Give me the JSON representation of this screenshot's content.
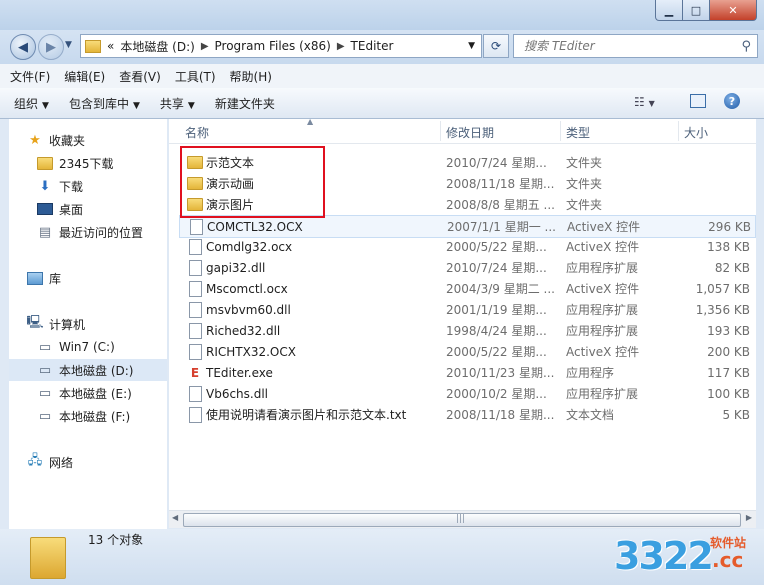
{
  "address": {
    "back_symbol": "«",
    "segments": [
      "本地磁盘 (D:)",
      "Program Files (x86)",
      "TEditer"
    ]
  },
  "search": {
    "placeholder": "搜索 TEditer"
  },
  "menu": [
    "文件(F)",
    "编辑(E)",
    "查看(V)",
    "工具(T)",
    "帮助(H)"
  ],
  "commands": [
    "组织",
    "包含到库中",
    "共享",
    "新建文件夹"
  ],
  "nav": {
    "favorites": "收藏夹",
    "fav_items": [
      "2345下载",
      "下载",
      "桌面",
      "最近访问的位置"
    ],
    "library": "库",
    "computer": "计算机",
    "drives": [
      "Win7 (C:)",
      "本地磁盘 (D:)",
      "本地磁盘 (E:)",
      "本地磁盘 (F:)"
    ],
    "network": "网络"
  },
  "columns": {
    "name": "名称",
    "date": "修改日期",
    "type": "类型",
    "size": "大小"
  },
  "files": [
    {
      "name": "示范文本",
      "date": "2010/7/24 星期...",
      "type": "文件夹",
      "size": "",
      "kind": "folder"
    },
    {
      "name": "演示动画",
      "date": "2008/11/18 星期...",
      "type": "文件夹",
      "size": "",
      "kind": "folder"
    },
    {
      "name": "演示图片",
      "date": "2008/8/8 星期五 ...",
      "type": "文件夹",
      "size": "",
      "kind": "folder"
    },
    {
      "name": "COMCTL32.OCX",
      "date": "2007/1/1 星期一 ...",
      "type": "ActiveX 控件",
      "size": "296 KB",
      "kind": "file"
    },
    {
      "name": "Comdlg32.ocx",
      "date": "2000/5/22 星期...",
      "type": "ActiveX 控件",
      "size": "138 KB",
      "kind": "file"
    },
    {
      "name": "gapi32.dll",
      "date": "2010/7/24 星期...",
      "type": "应用程序扩展",
      "size": "82 KB",
      "kind": "file"
    },
    {
      "name": "Mscomctl.ocx",
      "date": "2004/3/9 星期二 ...",
      "type": "ActiveX 控件",
      "size": "1,057 KB",
      "kind": "file"
    },
    {
      "name": "msvbvm60.dll",
      "date": "2001/1/19 星期...",
      "type": "应用程序扩展",
      "size": "1,356 KB",
      "kind": "file"
    },
    {
      "name": "Riched32.dll",
      "date": "1998/4/24 星期...",
      "type": "应用程序扩展",
      "size": "193 KB",
      "kind": "file"
    },
    {
      "name": "RICHTX32.OCX",
      "date": "2000/5/22 星期...",
      "type": "ActiveX 控件",
      "size": "200 KB",
      "kind": "file"
    },
    {
      "name": "TEditer.exe",
      "date": "2010/11/23 星期...",
      "type": "应用程序",
      "size": "117 KB",
      "kind": "exe"
    },
    {
      "name": "Vb6chs.dll",
      "date": "2000/10/2 星期...",
      "type": "应用程序扩展",
      "size": "100 KB",
      "kind": "file"
    },
    {
      "name": "使用说明请看演示图片和示范文本.txt",
      "date": "2008/11/18 星期...",
      "type": "文本文档",
      "size": "5 KB",
      "kind": "file"
    }
  ],
  "status": {
    "count": "13 个对象"
  },
  "watermark": {
    "number": "3322",
    "site": "软件站",
    "domain": ".cc"
  },
  "colors": {
    "highlight_box": "#e0101f",
    "selected_drive": "#dce8f6"
  }
}
